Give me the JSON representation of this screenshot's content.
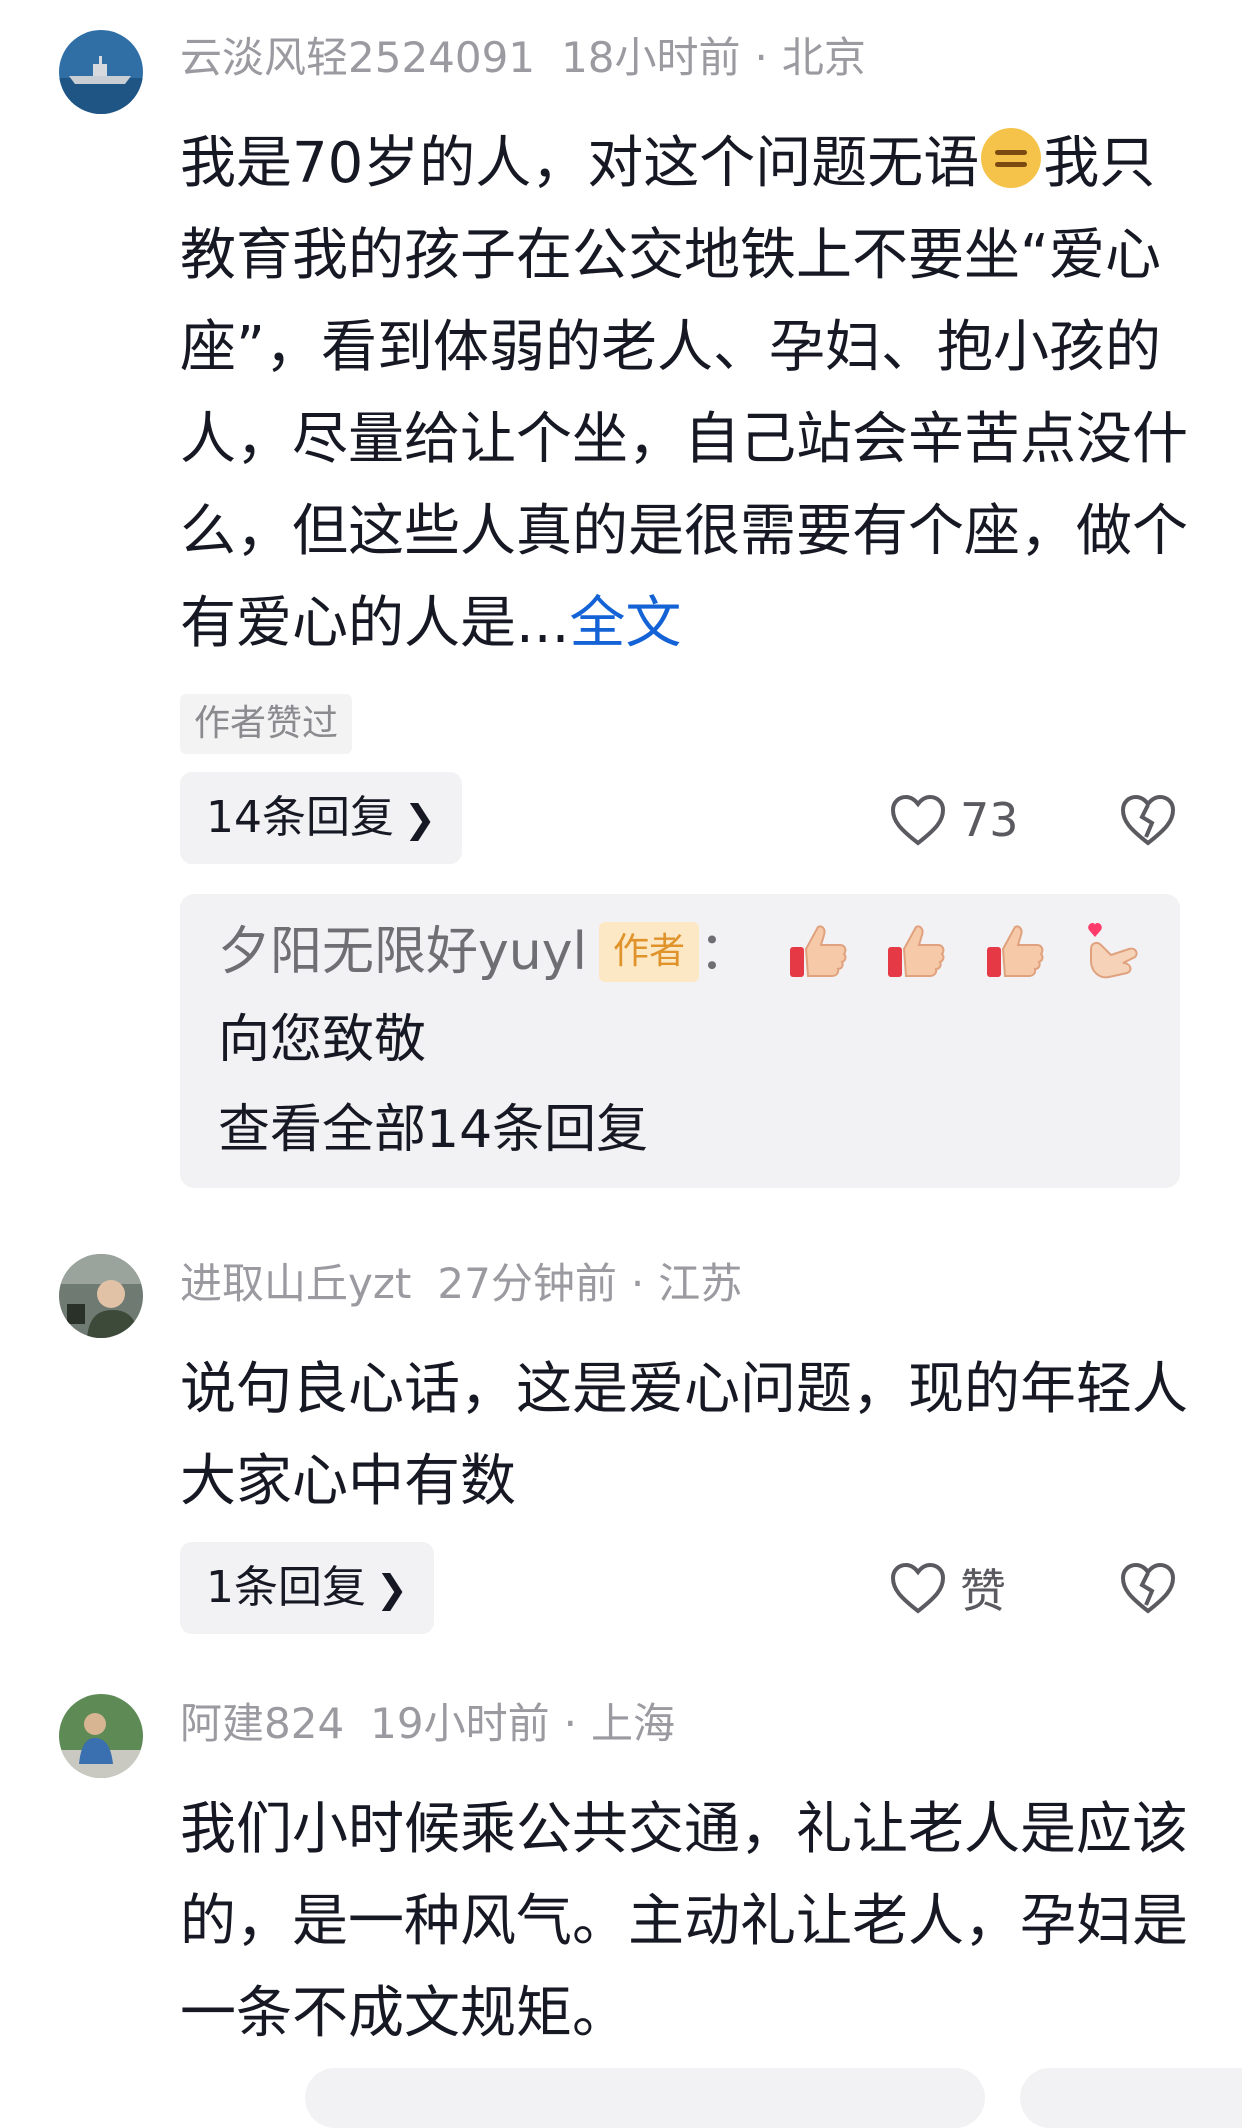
{
  "comments": [
    {
      "username": "云淡风轻2524091",
      "time": "18小时前",
      "separator": "·",
      "location": "北京",
      "text_part1": "我是70岁的人，对这个问题无语",
      "emoji": "expressionless-face-emoji",
      "text_part2": "我只教育我的孩子在公交地铁上不要坐“爱心座”，看到体弱的老人、孕妇、抱小孩的人，尽量给让个坐，自己站会辛苦点没什么，但这些人真的是很需要有个座，做个有爱心的人是...",
      "full_text_link": "全文",
      "author_liked_tag": "作者赞过",
      "replies_label": "14条回复",
      "like_count": "73",
      "reply_preview": {
        "author": "夕阳无限好yuyl",
        "author_badge": "作者",
        "colon": "：",
        "emojis": [
          "thumbs-up-emoji",
          "thumbs-up-emoji",
          "thumbs-up-emoji",
          "finger-heart-emoji"
        ],
        "text": "向您致敬",
        "view_all": "查看全部14条回复"
      }
    },
    {
      "username": "进取山丘yzt",
      "time": "27分钟前",
      "separator": "·",
      "location": "江苏",
      "text": "说句良心话，这是爱心问题，现的年轻人大家心中有数",
      "replies_label": "1条回复",
      "like_label": "赞"
    },
    {
      "username": "阿建824",
      "time": "19小时前",
      "separator": "·",
      "location": "上海",
      "text": "我们小时候乘公共交通，礼让老人是应该的，是一种风气。主动礼让老人，孕妇是一条不成文规矩。"
    }
  ],
  "icons": {
    "like": "heart-outline-icon",
    "dislike": "broken-heart-icon",
    "chevron": "chevron-right-icon"
  },
  "colors": {
    "link": "#1463d6",
    "meta": "#9a9aa0",
    "pill_bg": "#f2f2f4",
    "badge_bg": "#fde8c6",
    "badge_text": "#e0932b"
  }
}
